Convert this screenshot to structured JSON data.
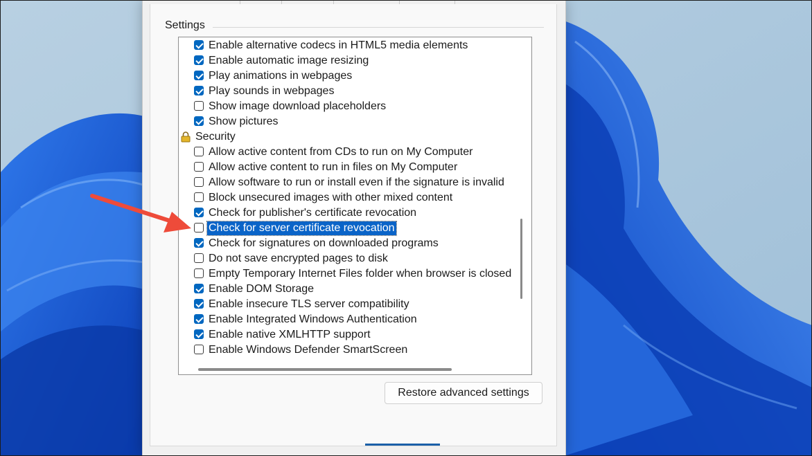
{
  "dialog": {
    "group_label": "Settings",
    "restore_button": "Restore advanced settings"
  },
  "settings": {
    "items": [
      {
        "label": "Enable alternative codecs in HTML5 media elements",
        "checked": true
      },
      {
        "label": "Enable automatic image resizing",
        "checked": true
      },
      {
        "label": "Play animations in webpages",
        "checked": true
      },
      {
        "label": "Play sounds in webpages",
        "checked": true
      },
      {
        "label": "Show image download placeholders",
        "checked": false
      },
      {
        "label": "Show pictures",
        "checked": true
      },
      {
        "label": "Security",
        "category": true,
        "icon": "lock-icon"
      },
      {
        "label": "Allow active content from CDs to run on My Computer",
        "checked": false
      },
      {
        "label": "Allow active content to run in files on My Computer",
        "checked": false
      },
      {
        "label": "Allow software to run or install even if the signature is invalid",
        "checked": false
      },
      {
        "label": "Block unsecured images with other mixed content",
        "checked": false
      },
      {
        "label": "Check for publisher's certificate revocation",
        "checked": true
      },
      {
        "label": "Check for server certificate revocation",
        "checked": false,
        "selected": true
      },
      {
        "label": "Check for signatures on downloaded programs",
        "checked": true
      },
      {
        "label": "Do not save encrypted pages to disk",
        "checked": false
      },
      {
        "label": "Empty Temporary Internet Files folder when browser is closed",
        "checked": false
      },
      {
        "label": "Enable DOM Storage",
        "checked": true
      },
      {
        "label": "Enable insecure TLS server compatibility",
        "checked": true
      },
      {
        "label": "Enable Integrated Windows Authentication",
        "checked": true
      },
      {
        "label": "Enable native XMLHTTP support",
        "checked": true
      },
      {
        "label": "Enable Windows Defender SmartScreen",
        "checked": false
      }
    ]
  },
  "annotation": {
    "type": "arrow",
    "color": "#ee4b3a",
    "points_to": "Check for server certificate revocation"
  },
  "colors": {
    "accent": "#0067c0",
    "selection": "#0a64c8",
    "wallpaper": "#1f5fd6"
  }
}
